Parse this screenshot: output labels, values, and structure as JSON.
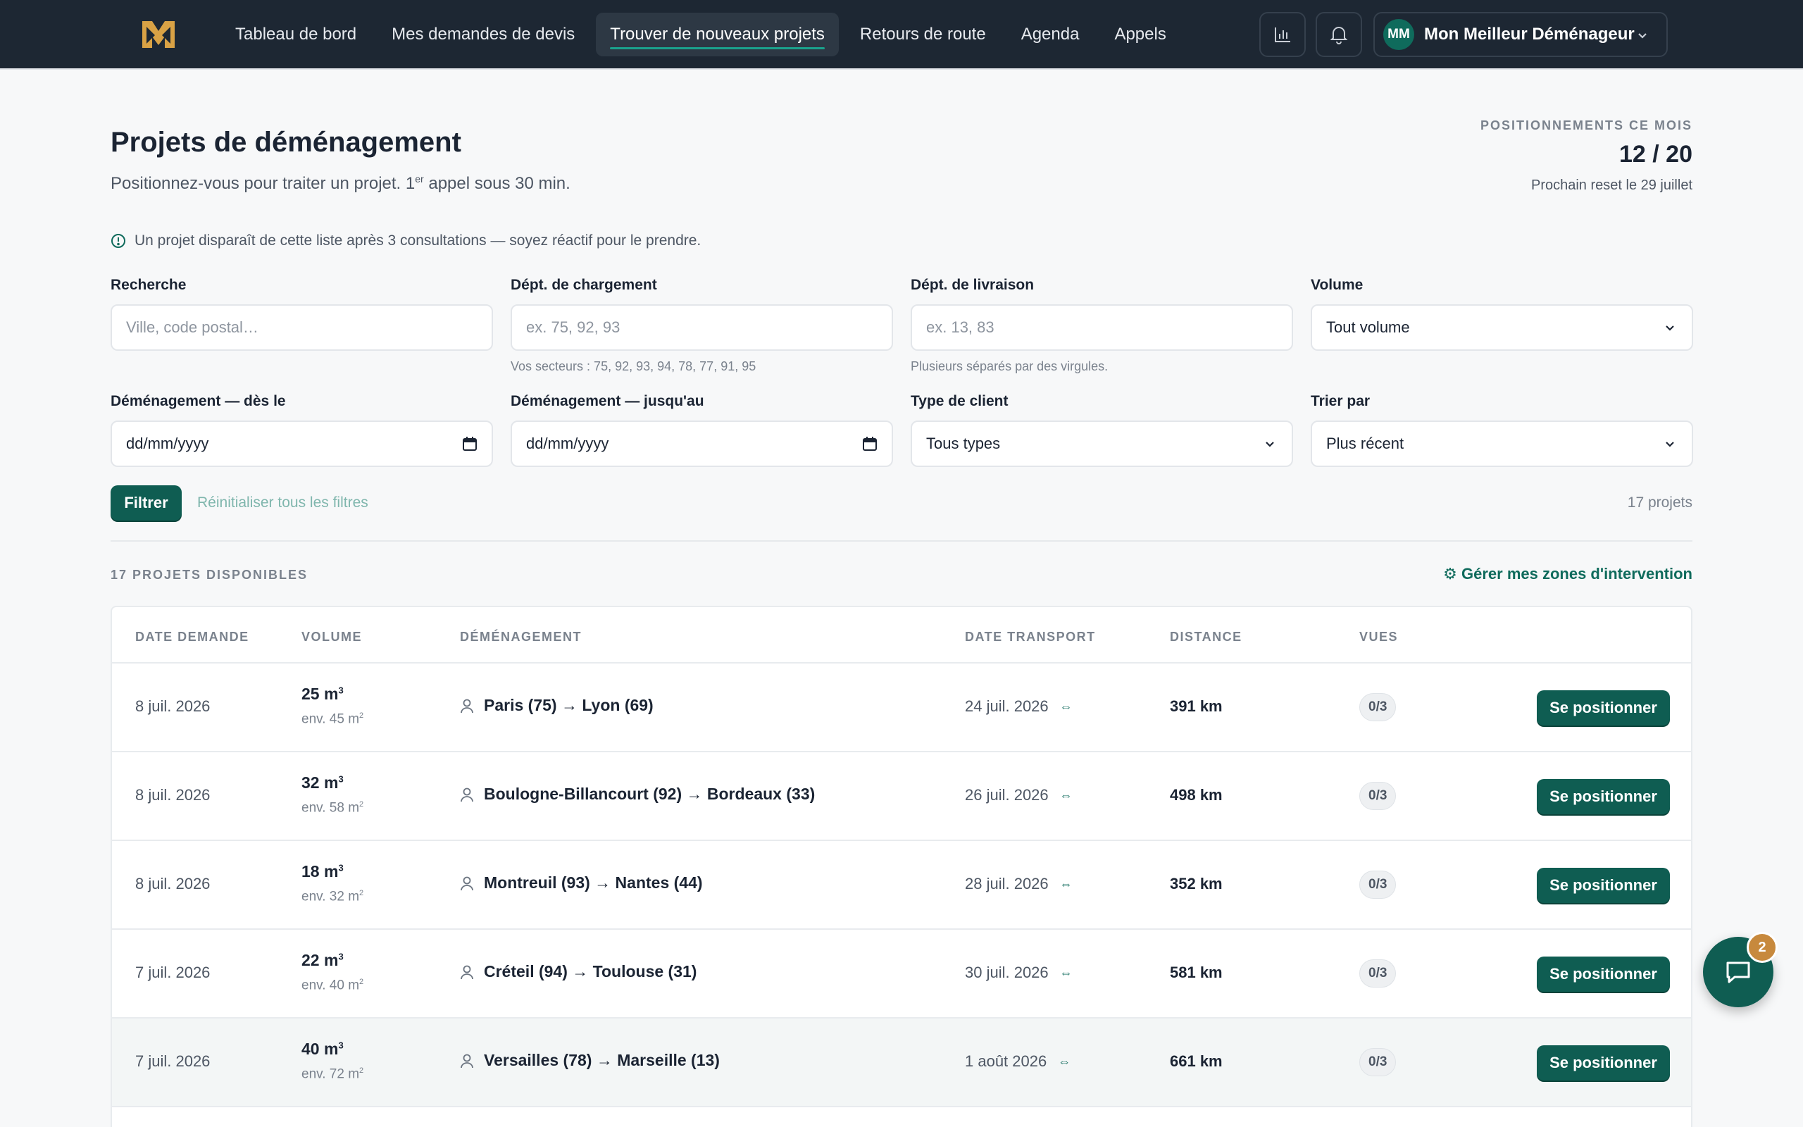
{
  "nav": {
    "items": [
      {
        "label": "Tableau de bord",
        "active": false
      },
      {
        "label": "Mes demandes de devis",
        "active": false
      },
      {
        "label": "Trouver de nouveaux projets",
        "active": true
      },
      {
        "label": "Retours de route",
        "active": false
      },
      {
        "label": "Agenda",
        "active": false
      },
      {
        "label": "Appels",
        "active": false
      }
    ],
    "user": {
      "initials": "MM",
      "name": "Mon Meilleur Déménageur"
    }
  },
  "header": {
    "title": "Projets de déménagement",
    "subtitle_before": "Positionnez-vous pour traiter un projet. 1",
    "subtitle_sup": "er",
    "subtitle_after": " appel sous 30 min.",
    "quota_label": "POSITIONNEMENTS CE MOIS",
    "quota_value": "12 / 20",
    "quota_reset": "Prochain reset le 29 juillet"
  },
  "info": "Un projet disparaît de cette liste après 3 consultations — soyez réactif pour le prendre.",
  "filters": {
    "search": {
      "label": "Recherche",
      "placeholder": "Ville, code postal…"
    },
    "load_dept": {
      "label": "Dépt. de chargement",
      "placeholder": "ex. 75, 92, 93",
      "hint": "Vos secteurs : 75, 92, 93, 94, 78, 77, 91, 95"
    },
    "delivery_dept": {
      "label": "Dépt. de livraison",
      "placeholder": "ex. 13, 83",
      "hint": "Plusieurs séparés par des virgules."
    },
    "volume": {
      "label": "Volume",
      "value": "Tout volume"
    },
    "from_date": {
      "label": "Déménagement — dès le",
      "value": "dd/mm/yyyy"
    },
    "to_date": {
      "label": "Déménagement — jusqu'au",
      "value": "dd/mm/yyyy"
    },
    "client_type": {
      "label": "Type de client",
      "value": "Tous types"
    },
    "sort": {
      "label": "Trier par",
      "value": "Plus récent"
    },
    "filter_button": "Filtrer",
    "reset_link": "Réinitialiser tous les filtres",
    "count": "17 projets"
  },
  "list": {
    "section_title": "17 PROJETS DISPONIBLES",
    "zones_link": "⚙ Gérer mes zones d'intervention",
    "columns": [
      "DATE DEMANDE",
      "VOLUME",
      "DÉMÉNAGEMENT",
      "DATE TRANSPORT",
      "DISTANCE",
      "VUES"
    ],
    "rows": [
      {
        "date": "8 juil. 2026",
        "volume": "25 m",
        "area": "env. 45 m",
        "route": "Paris (75) → Lyon (69)",
        "transport": "24 juil. 2026",
        "distance": "391 km",
        "views": "0/3",
        "action": "Se positionner"
      },
      {
        "date": "8 juil. 2026",
        "volume": "32 m",
        "area": "env. 58 m",
        "route": "Boulogne-Billancourt (92) → Bordeaux (33)",
        "transport": "26 juil. 2026",
        "distance": "498 km",
        "views": "0/3",
        "action": "Se positionner"
      },
      {
        "date": "8 juil. 2026",
        "volume": "18 m",
        "area": "env. 32 m",
        "route": "Montreuil (93) → Nantes (44)",
        "transport": "28 juil. 2026",
        "distance": "352 km",
        "views": "0/3",
        "action": "Se positionner"
      },
      {
        "date": "7 juil. 2026",
        "volume": "22 m",
        "area": "env. 40 m",
        "route": "Créteil (94) → Toulouse (31)",
        "transport": "30 juil. 2026",
        "distance": "581 km",
        "views": "0/3",
        "action": "Se positionner"
      },
      {
        "date": "7 juil. 2026",
        "volume": "40 m",
        "area": "env. 72 m",
        "route": "Versailles (78) → Marseille (13)",
        "transport": "1 août 2026",
        "distance": "661 km",
        "views": "0/3",
        "action": "Se positionner"
      }
    ],
    "volume_sup": "3",
    "area_sup": "2",
    "flex_icon": "⇔"
  },
  "chat": {
    "badge": "2"
  },
  "colors": {
    "nav_bg": "#1d2733",
    "primary": "#0f5d52",
    "accent": "#1aa38d",
    "badge": "#c7893d"
  }
}
